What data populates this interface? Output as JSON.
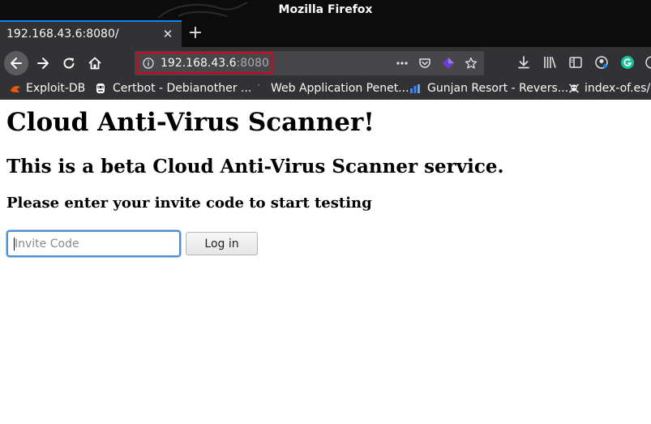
{
  "window": {
    "title": "Mozilla Firefox"
  },
  "tab": {
    "label": "192.168.43.6:8080/"
  },
  "urlbar": {
    "host": "192.168.43.6",
    "port": ":8080"
  },
  "bookmarks": [
    {
      "label": "Exploit-DB",
      "icon": "exploit-db-icon"
    },
    {
      "label": "Certbot - Debianother ...",
      "icon": "certbot-icon"
    },
    {
      "label": "Web Application Penet...",
      "icon": "page-icon"
    },
    {
      "label": "Gunjan Resort - Revers...",
      "icon": "bar-chart-icon"
    },
    {
      "label": "index-of.es/",
      "icon": "skull-icon"
    }
  ],
  "page": {
    "heading1": "Cloud Anti-Virus Scanner!",
    "heading2": "This is a beta Cloud Anti-Virus Scanner service.",
    "heading3": "Please enter your invite code to start testing",
    "invite_placeholder": "Invite Code",
    "login_label": "Log in"
  },
  "colors": {
    "chrome_dark": "#0c0c0d",
    "toolbar": "#323234",
    "tab_accent": "#0a84ff",
    "url_highlight": "#d70022"
  }
}
